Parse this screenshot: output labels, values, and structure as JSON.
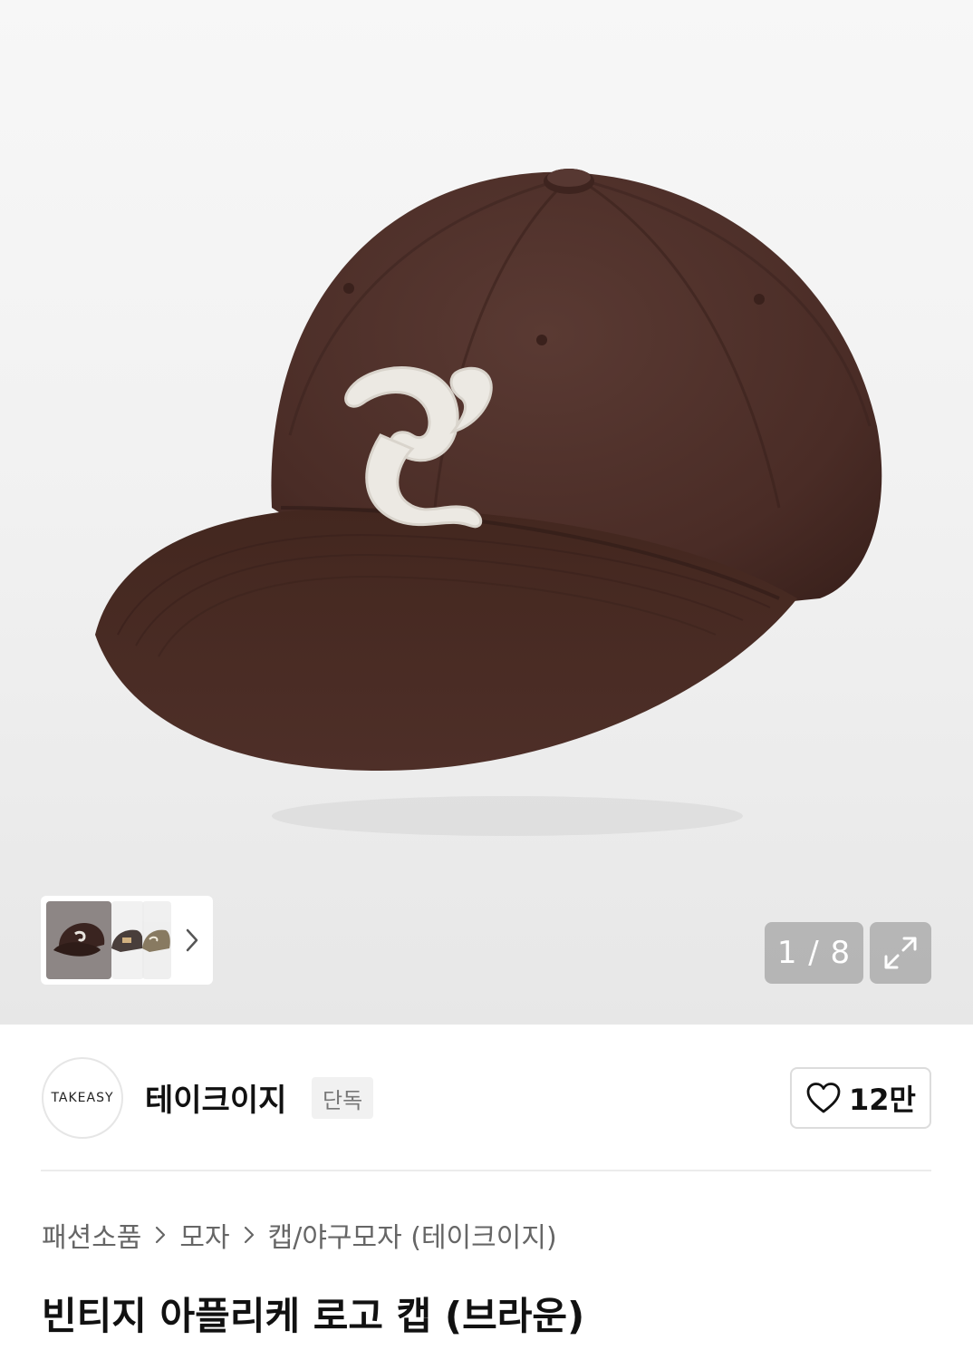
{
  "gallery": {
    "current_page": "1",
    "separator": "/",
    "total_pages": "8",
    "counter_text": "1 / 8",
    "main_image": "brown-baseball-cap-with-q-logo",
    "thumbnails": [
      "brown-cap-thumbnail",
      "black-cap-thumbnail",
      "olive-cap-thumbnail"
    ],
    "next_icon": "chevron-right-icon",
    "expand_icon": "expand-icon"
  },
  "brand": {
    "logo_text": "TAKEASY",
    "name": "테이크이지",
    "badge": "단독"
  },
  "like": {
    "icon": "heart-outline-icon",
    "count": "12만"
  },
  "breadcrumb": {
    "items": [
      "패션소품",
      "모자",
      "캡/야구모자 (테이크이지)"
    ],
    "separator_icon": "chevron-right-icon"
  },
  "product": {
    "title": "빈티지 아플리케 로고 캡 (브라운)"
  },
  "colors": {
    "cap_brown": "#4a2c26",
    "patch_white": "#ece9e3",
    "overlay_gray": "#969696"
  }
}
